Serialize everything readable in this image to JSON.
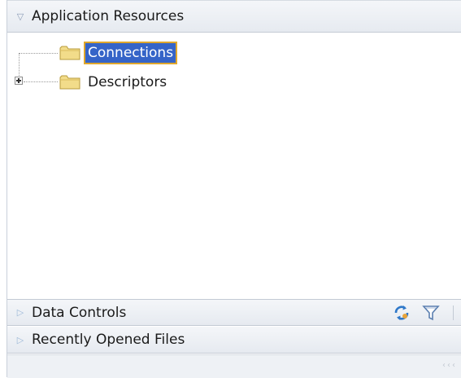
{
  "panels": {
    "application_resources": {
      "label": "Application Resources",
      "expanded": true
    },
    "data_controls": {
      "label": "Data Controls",
      "expanded": false,
      "tools": {
        "refresh_icon": "refresh-icon",
        "filter_icon": "filter-icon"
      }
    },
    "recently_opened_files": {
      "label": "Recently Opened Files",
      "expanded": false
    }
  },
  "tree": {
    "nodes": [
      {
        "label": "Connections",
        "icon": "folder-icon",
        "selected": true,
        "expandable": false
      },
      {
        "label": "Descriptors",
        "icon": "folder-icon",
        "selected": false,
        "expandable": true
      }
    ]
  },
  "status_strip": {
    "grip_icon": "scroll-grip-icon"
  },
  "colors": {
    "selection_bg": "#3564c8",
    "selection_outline": "#e0a72c",
    "folder_fill": "#f2dc8a",
    "header_bg": "#e6eaf0"
  }
}
